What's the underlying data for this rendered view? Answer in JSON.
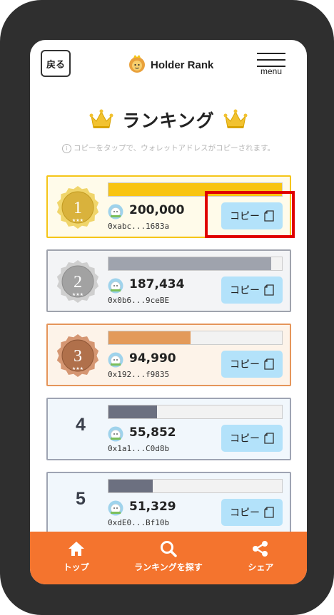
{
  "header": {
    "back_label": "戻る",
    "logo_text": "Holder Rank",
    "menu_label": "menu"
  },
  "page": {
    "title": "ランキング",
    "hint": "コピーをタップで、ウォレットアドレスがコピーされます。",
    "hint_icon": "i"
  },
  "rankings": [
    {
      "rank": "1",
      "amount": "200,000",
      "address": "0xabc...1683a",
      "copy_label": "コピー",
      "progress": 1.0,
      "color": "#f8c412",
      "border": "#f5c518",
      "bg": "#fffbea",
      "medal": "gold"
    },
    {
      "rank": "2",
      "amount": "187,434",
      "address": "0x0b6...9ceBE",
      "copy_label": "コピー",
      "progress": 0.937,
      "color": "#9fa3ad",
      "border": "#9fa3ad",
      "bg": "#f3f4f6",
      "medal": "silver"
    },
    {
      "rank": "3",
      "amount": "94,990",
      "address": "0x192...f9835",
      "copy_label": "コピー",
      "progress": 0.475,
      "color": "#e39a5a",
      "border": "#e5955a",
      "bg": "#fdf3e9",
      "medal": "bronze"
    },
    {
      "rank": "4",
      "amount": "55,852",
      "address": "0x1a1...C0d8b",
      "copy_label": "コピー",
      "progress": 0.279,
      "color": "#6c7080",
      "border": "#9ea4b3",
      "bg": "#f1f7fc",
      "medal": "none"
    },
    {
      "rank": "5",
      "amount": "51,329",
      "address": "0xdE0...Bf10b",
      "copy_label": "コピー",
      "progress": 0.257,
      "color": "#6c7080",
      "border": "#9ea4b3",
      "bg": "#f1f7fc",
      "medal": "none"
    }
  ],
  "nav": {
    "home_label": "トップ",
    "search_label": "ランキングを探す",
    "share_label": "シェア"
  },
  "colors": {
    "accent": "#f4742e",
    "copy_button": "#b3e2fa",
    "highlight": "#e00000"
  }
}
